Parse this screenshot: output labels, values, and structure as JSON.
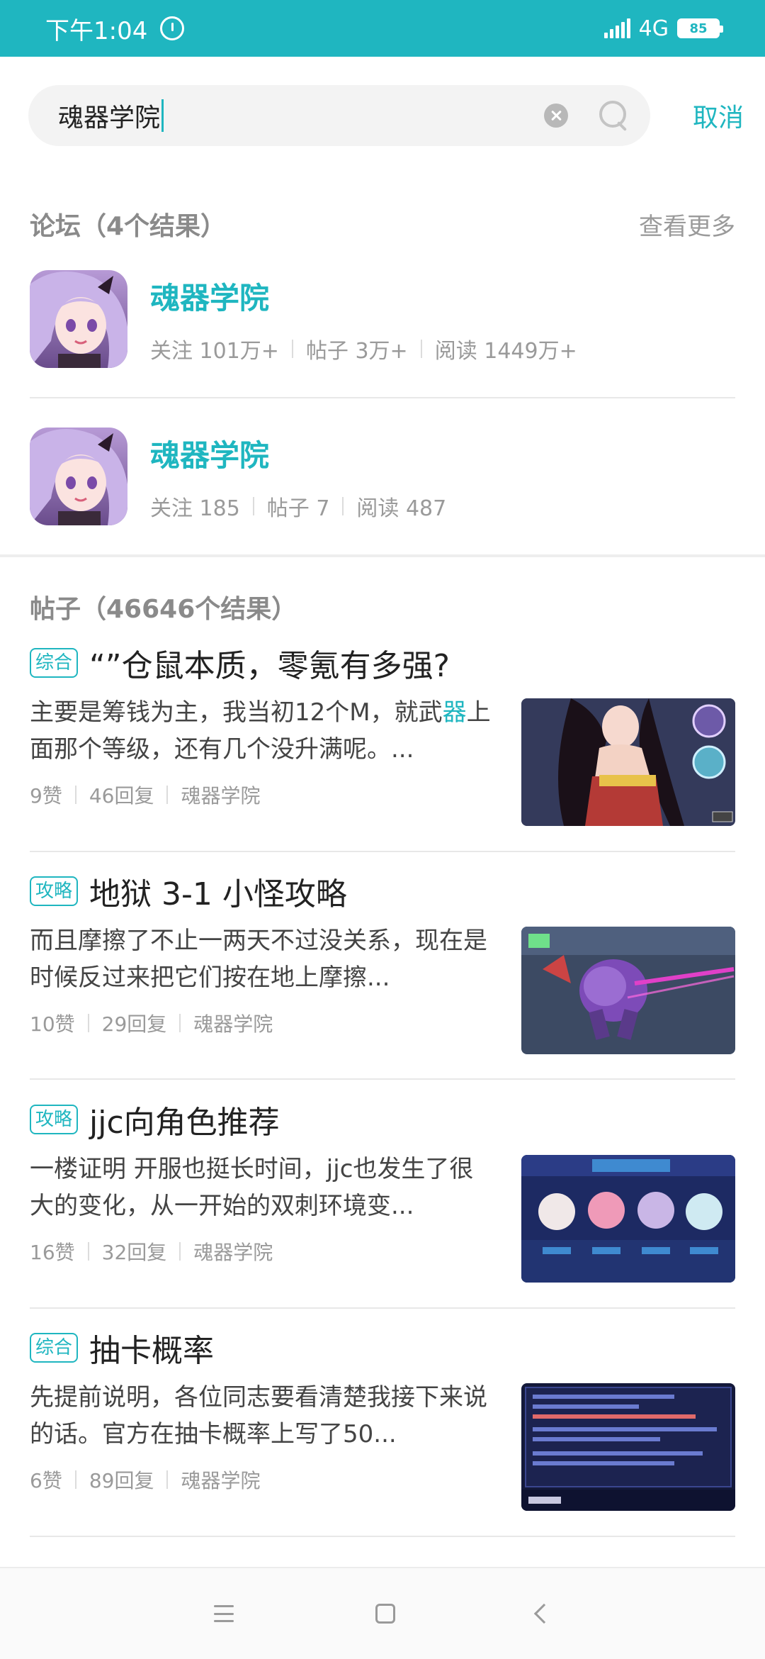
{
  "status_bar": {
    "time": "下午1:04",
    "network": "4G",
    "battery": "85"
  },
  "search": {
    "query": "魂器学院",
    "cancel_label": "取消"
  },
  "forum_section": {
    "title": "论坛（4个结果）",
    "more_label": "查看更多",
    "items": [
      {
        "name": "魂器学院",
        "follow": "关注 101万+",
        "posts": "帖子 3万+",
        "reads": "阅读 1449万+"
      },
      {
        "name": "魂器学院",
        "follow": "关注 185",
        "posts": "帖子 7",
        "reads": "阅读 487"
      }
    ]
  },
  "post_section": {
    "title": "帖子（46646个结果）",
    "items": [
      {
        "tag": "综合",
        "title": "“”仓鼠本质，零氪有多强?",
        "excerpt_pre": "主要是筹钱为主，我当初12个M，就武",
        "excerpt_hl": "器",
        "excerpt_post": "上面那个等级，还有几个没升满呢。...",
        "likes": "9赞",
        "replies": "46回复",
        "forum": "魂器学院"
      },
      {
        "tag": "攻略",
        "title": "地狱 3-1  小怪攻略",
        "excerpt_pre": "而且摩擦了不止一两天不过没关系，现在是时候反过来把它们按在地上摩擦...",
        "excerpt_hl": "",
        "excerpt_post": "",
        "likes": "10赞",
        "replies": "29回复",
        "forum": "魂器学院"
      },
      {
        "tag": "攻略",
        "title": "jjc向角色推荐",
        "excerpt_pre": "一楼证明 开服也挺长时间，jjc也发生了很大的变化，从一开始的双刺环境变...",
        "excerpt_hl": "",
        "excerpt_post": "",
        "likes": "16赞",
        "replies": "32回复",
        "forum": "魂器学院"
      },
      {
        "tag": "综合",
        "title": "抽卡概率",
        "excerpt_pre": "先提前说明，各位同志要看清楚我接下来说的话。官方在抽卡概率上写了50...",
        "excerpt_hl": "",
        "excerpt_post": "",
        "likes": "6赞",
        "replies": "89回复",
        "forum": "魂器学院"
      }
    ]
  }
}
